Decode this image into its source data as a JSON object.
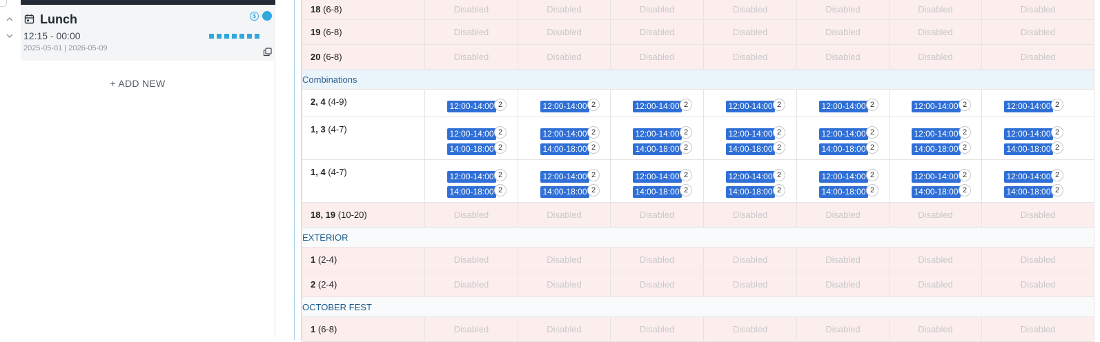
{
  "service": {
    "name": "Lunch",
    "time_range": "12:15 - 00:00",
    "date_range": "2025-05-01 | 2026-05-09",
    "accent_color": "#2fa8e0",
    "icons": [
      "calendar-icon",
      "dollar-icon",
      "copy-icon",
      "chevron-up-icon",
      "chevron-down-icon"
    ]
  },
  "left_panel": {
    "add_new_label": "+ ADD NEW"
  },
  "grid": {
    "disabled_label": "Disabled",
    "day_column_count": 7,
    "rows": [
      {
        "type": "disabled",
        "name": "18",
        "capacity": "(6-8)"
      },
      {
        "type": "disabled",
        "name": "19",
        "capacity": "(6-8)"
      },
      {
        "type": "disabled",
        "name": "20",
        "capacity": "(6-8)"
      },
      {
        "type": "combo_header",
        "label": "Combinations"
      },
      {
        "type": "slots",
        "name": "2, 4",
        "capacity": "(4-9)",
        "slots": [
          {
            "time": "12:00-14:00",
            "count": "2"
          }
        ]
      },
      {
        "type": "slots",
        "name": "1, 3",
        "capacity": "(4-7)",
        "slots": [
          {
            "time": "12:00-14:00",
            "count": "2"
          },
          {
            "time": "14:00-18:00",
            "count": "2"
          }
        ]
      },
      {
        "type": "slots",
        "name": "1, 4",
        "capacity": "(4-7)",
        "slots": [
          {
            "time": "12:00-14:00",
            "count": "2"
          },
          {
            "time": "14:00-18:00",
            "count": "2"
          }
        ]
      },
      {
        "type": "disabled",
        "name": "18, 19",
        "capacity": "(10-20)"
      },
      {
        "type": "section",
        "label": "EXTERIOR"
      },
      {
        "type": "disabled",
        "name": "1",
        "capacity": "(2-4)"
      },
      {
        "type": "disabled",
        "name": "2",
        "capacity": "(2-4)"
      },
      {
        "type": "section",
        "label": "OCTOBER FEST"
      },
      {
        "type": "disabled",
        "name": "1",
        "capacity": "(6-8)"
      }
    ]
  }
}
